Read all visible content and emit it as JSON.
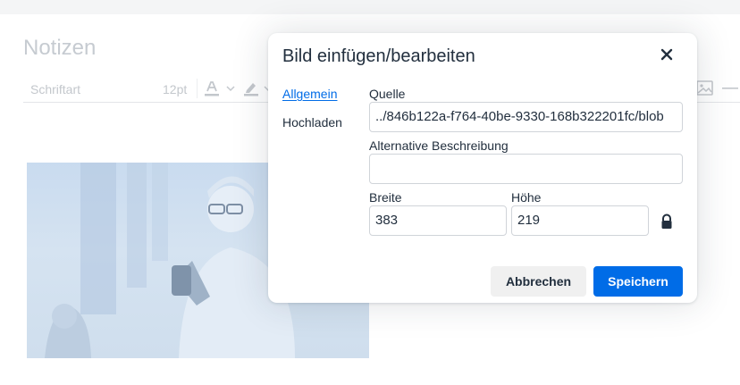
{
  "editor": {
    "title": "Notizen",
    "font_family_label": "Schriftart",
    "font_size_label": "12pt"
  },
  "dialog": {
    "title": "Bild einfügen/bearbeiten",
    "tabs": [
      {
        "label": "Allgemein",
        "active": true
      },
      {
        "label": "Hochladen",
        "active": false
      }
    ],
    "source": {
      "label": "Quelle",
      "value": "../846b122a-f764-40be-9330-168b322201fc/blob"
    },
    "alt": {
      "label": "Alternative Beschreibung",
      "value": ""
    },
    "width": {
      "label": "Breite",
      "value": "383"
    },
    "height": {
      "label": "Höhe",
      "value": "219"
    },
    "cancel_label": "Abbrechen",
    "save_label": "Speichern"
  },
  "colors": {
    "accent": "#006ce7",
    "text": "#222f3e",
    "border": "#d0d4d9"
  },
  "icons": [
    "close-icon",
    "lock-icon",
    "text-color-icon",
    "highlight-icon",
    "image-icon",
    "chevron-down-icon"
  ]
}
